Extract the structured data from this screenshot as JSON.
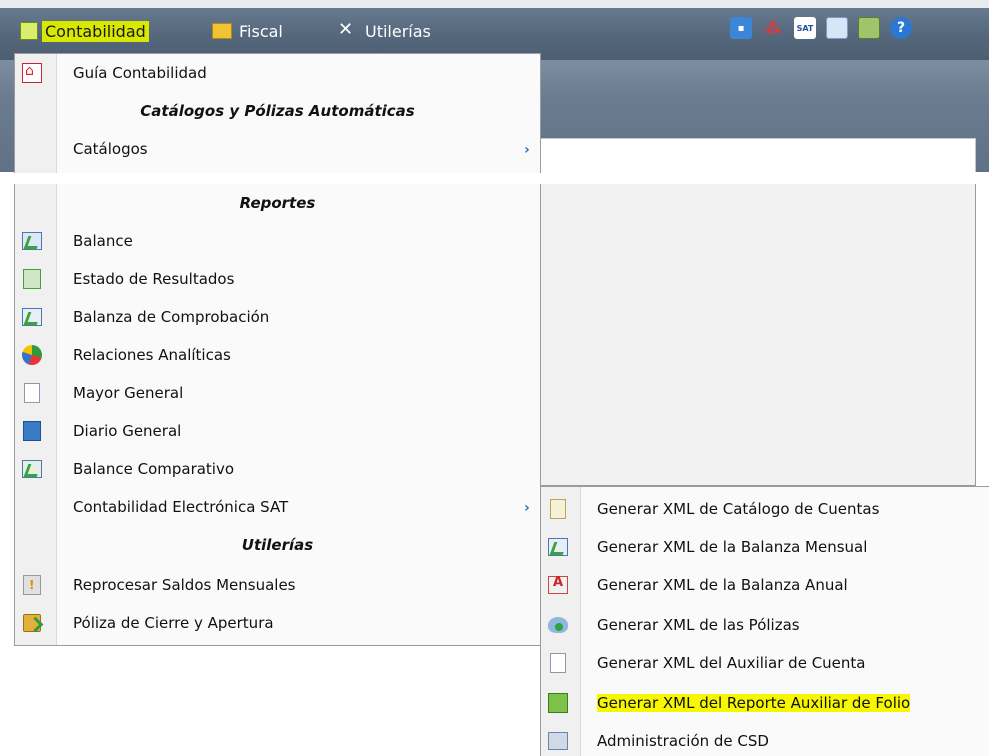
{
  "menubar": {
    "items": [
      {
        "label": "Contabilidad",
        "icon": "ledger-icon"
      },
      {
        "label": "Fiscal",
        "icon": "folder-icon"
      },
      {
        "label": "Utilerías",
        "icon": "tools-icon"
      }
    ],
    "tool_icons": [
      "video-icon",
      "network-icon",
      "sat-icon",
      "calculator-icon",
      "exit-door-icon",
      "help-icon"
    ],
    "tool_labels": {
      "sat": "SAT",
      "help": "?"
    }
  },
  "contabilidad_menu": {
    "top_items": [
      {
        "label": "Guía Contabilidad",
        "icon": "pdf-icon"
      },
      {
        "label": "Catálogos y Pólizas Automáticas",
        "header": true
      },
      {
        "label": "Catálogos",
        "submenu": true
      }
    ],
    "items": [
      {
        "label": "Reportes",
        "header": true
      },
      {
        "label": "Balance",
        "icon": "balance-icon"
      },
      {
        "label": "Estado de Resultados",
        "icon": "green-document-icon"
      },
      {
        "label": "Balanza de Comprobación",
        "icon": "chart-check-icon"
      },
      {
        "label": "Relaciones Analíticas",
        "icon": "pie-chart-icon"
      },
      {
        "label": "Mayor General",
        "icon": "document-icon"
      },
      {
        "label": "Diario General",
        "icon": "blue-book-icon"
      },
      {
        "label": "Balance Comparativo",
        "icon": "compare-icon"
      },
      {
        "label": "Contabilidad Electrónica SAT",
        "submenu": true
      },
      {
        "label": "Utilerías",
        "header": true
      },
      {
        "label": "Reprocesar Saldos Mensuales",
        "icon": "warning-icon"
      },
      {
        "label": "Póliza de Cierre y Apertura",
        "icon": "lock-icon"
      }
    ]
  },
  "sat_submenu": {
    "items": [
      {
        "label": "Generar XML de Catálogo de Cuentas",
        "icon": "catalog-icon"
      },
      {
        "label": "Generar XML de la Balanza Mensual",
        "icon": "chart-check-icon"
      },
      {
        "label": "Generar XML de la Balanza Anual",
        "icon": "annual-balance-icon"
      },
      {
        "label": "Generar XML de las Pólizas",
        "icon": "policy-icon"
      },
      {
        "label": "Generar XML del Auxiliar de Cuenta",
        "icon": "document-icon"
      },
      {
        "label": "Generar XML del Reporte Auxiliar de Folio",
        "icon": "xml-folio-icon",
        "highlighted": true
      },
      {
        "label": "Administración de CSD",
        "icon": "csd-icon"
      }
    ]
  },
  "colors": {
    "highlight": "#f7f700",
    "active_menu": "#d8e800",
    "menubar": "#55677c",
    "arrow": "#2e6fc0"
  }
}
